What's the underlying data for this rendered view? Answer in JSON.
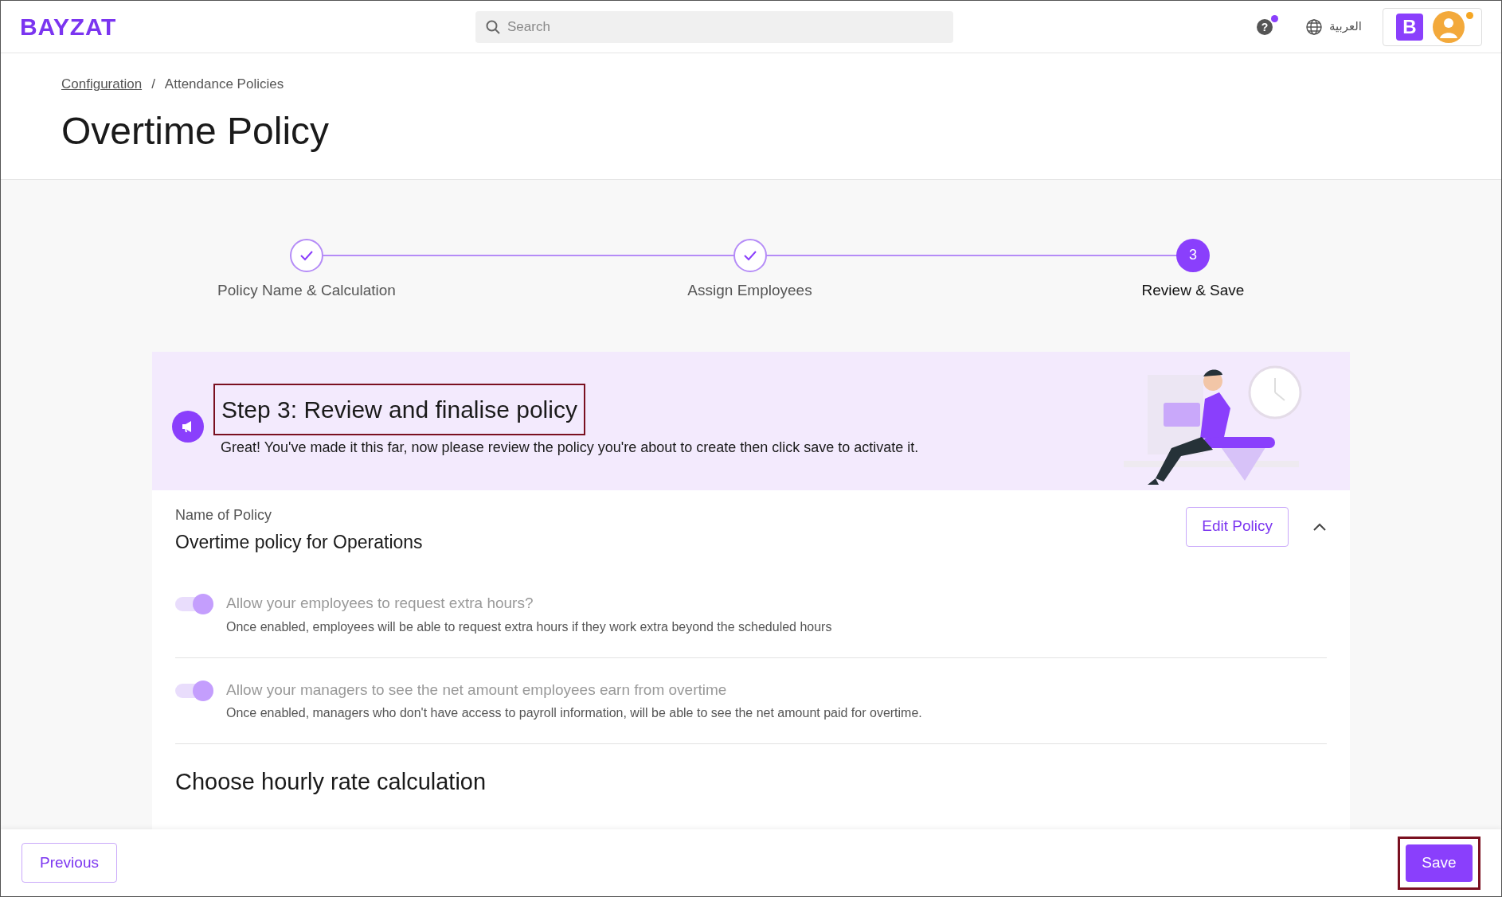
{
  "header": {
    "logo": "BAYZAT",
    "search": {
      "placeholder": "Search"
    },
    "help_label": "?",
    "help_notification": true,
    "language": "العربية",
    "account_notification": true,
    "company_initial": "B"
  },
  "breadcrumb": [
    {
      "label": "Configuration",
      "link": true
    },
    {
      "separator": "/",
      "label": "Attendance Policies",
      "link": false
    }
  ],
  "page_title": "Overtime Policy",
  "steps": [
    {
      "label": "Policy Name & Calculation",
      "completed": true,
      "selected": false
    },
    {
      "label": "Assign Employees",
      "completed": true,
      "selected": false
    },
    {
      "label": "Review & Save",
      "number": "3",
      "completed": false,
      "selected": true
    }
  ],
  "banner": {
    "title": "Step 3: Review and finalise policy",
    "highlighted": true,
    "text": "Great! You've made it this far, now please review the policy you're about to create then click save to activate it."
  },
  "policy": {
    "name_label": "Name of Policy",
    "name": "Overtime policy for Operations",
    "edit_button": "Edit Policy",
    "expanded": true,
    "settings": [
      {
        "title": "Allow your employees to request extra hours?",
        "description": "Once enabled, employees will be able to request extra hours if they work extra beyond the scheduled hours",
        "on": true,
        "disabled": true
      },
      {
        "title": "Allow your managers to see the net amount employees earn from overtime",
        "description": "Once enabled, managers who don't have access to payroll information, will be able to see the net amount paid for overtime.",
        "on": true,
        "disabled": true
      }
    ],
    "section_heading": "Choose hourly rate calculation"
  },
  "footer": {
    "previous": "Previous",
    "save": "Save",
    "save_highlighted": true
  }
}
